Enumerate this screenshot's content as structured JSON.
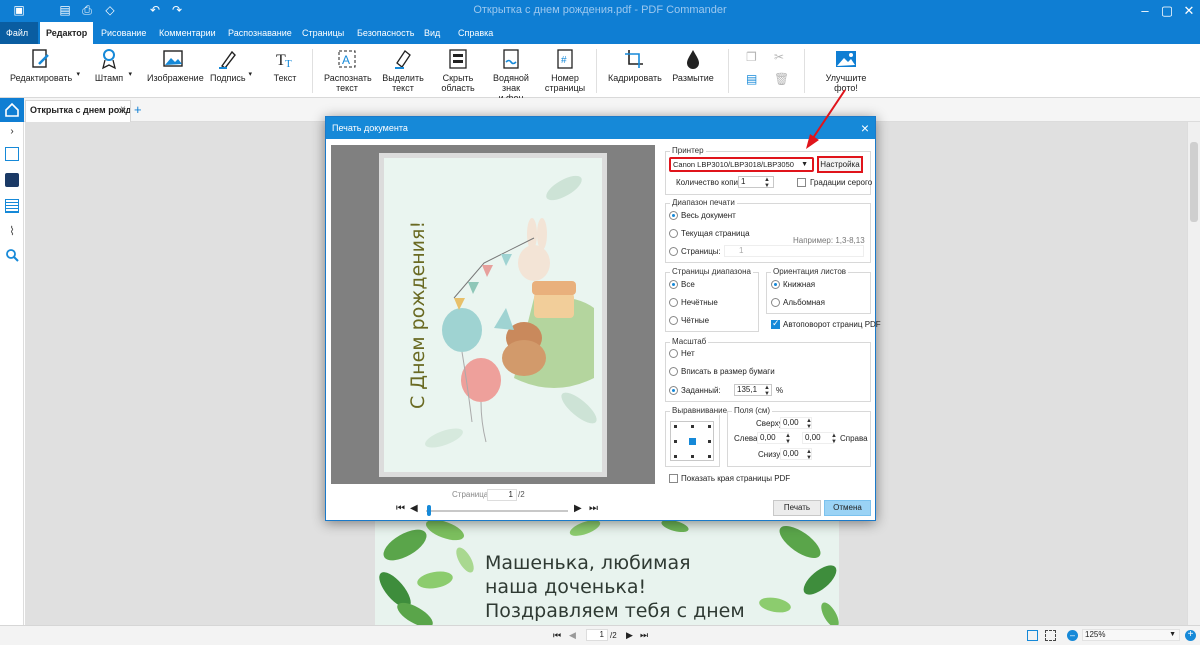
{
  "window": {
    "title": "Открытка с днем рождения.pdf - PDF Commander"
  },
  "menu": {
    "file": "Файл",
    "items": [
      "Редактор",
      "Рисование",
      "Комментарии",
      "Распознавание",
      "Страницы",
      "Безопасность",
      "Вид",
      "Справка"
    ]
  },
  "ribbon": {
    "edit": "Редактировать",
    "stamp": "Штамп",
    "image": "Изображение",
    "signature": "Подпись",
    "text": "Текст",
    "recognize": [
      "Распознать",
      "текст"
    ],
    "select_text": [
      "Выделить",
      "текст"
    ],
    "hide_area": [
      "Скрыть",
      "область"
    ],
    "watermark": [
      "Водяной знак",
      "и фон"
    ],
    "page_numbers": [
      "Номер",
      "страницы"
    ],
    "crop": "Кадрировать",
    "blur": "Размытие",
    "improve_photo": "Улучшите фото!"
  },
  "tabs": {
    "doc_tab": "Открытка с днем рожд...",
    "close": "×",
    "add": "+"
  },
  "dialog": {
    "title": "Печать документа",
    "printer_group": "Принтер",
    "printer_value": "Canon LBP3010/LBP3018/LBP3050",
    "settings_button": "Настройка",
    "copies_label": "Количество копий",
    "copies_value": "1",
    "grayscale": "Градации серого",
    "range_group": "Диапазон печати",
    "range_all": "Весь документ",
    "range_current": "Текущая страница",
    "range_pages": "Страницы:",
    "range_pages_value": "1",
    "range_example": "Например: 1,3-8,13",
    "subset_group": "Страницы диапазона",
    "subset_all": "Все",
    "subset_odd": "Нечётные",
    "subset_even": "Чётные",
    "orient_group": "Ориентация листов",
    "orient_portrait": "Книжная",
    "orient_landscape": "Альбомная",
    "autorotate": "Автоповорот страниц PDF",
    "scale_group": "Масштаб",
    "scale_none": "Нет",
    "scale_fit": "Вписать в размер бумаги",
    "scale_custom": "Заданный:",
    "scale_value": "135,1",
    "scale_unit": "%",
    "align_group": "Выравнивание",
    "margins_group": "Поля (см)",
    "margin_top_label": "Сверху",
    "margin_top": "0,00",
    "margin_left_label": "Слева",
    "margin_left": "0,00",
    "margin_right": "0,00",
    "margin_right_label": "Справа",
    "margin_bottom_label": "Снизу",
    "margin_bottom": "0,00",
    "show_edges": "Показать края страницы PDF",
    "page_label": "Страница:",
    "page_value": "1",
    "page_total": "/2",
    "print_button": "Печать",
    "cancel_button": "Отмена",
    "preview_card_text": "С Днем рождения!"
  },
  "page_text": [
    "Машенька, любимая",
    "наша доченька!",
    "Поздравляем тебя с днем"
  ],
  "status": {
    "page_value": "1",
    "page_total": "/2",
    "zoom": "125%"
  },
  "colors": {
    "accent": "#0f7ed3",
    "highlight": "#e0141b"
  }
}
